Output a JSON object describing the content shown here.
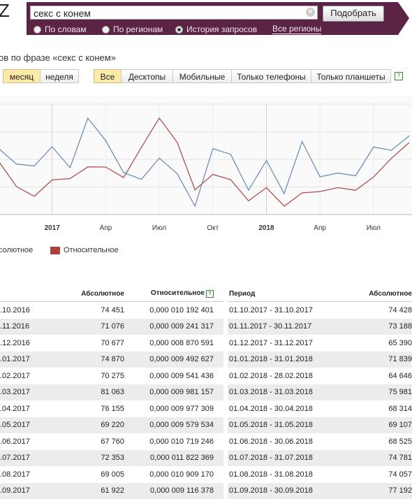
{
  "search": {
    "value": "секс с конем",
    "submit_label": "Подобрать",
    "modes": [
      "По словам",
      "По регионам",
      "История запросов"
    ],
    "selected_mode": "История запросов",
    "region_link": "Все регионы"
  },
  "corner_glyph": "Z",
  "subtitle": "ов по фразе «секс с конем»",
  "period_tabs": [
    "месяц",
    "неделя"
  ],
  "selected_period": "месяц",
  "device_tabs": [
    "Все",
    "Десктопы",
    "Мобильные",
    "Только телефоны",
    "Только планшеты"
  ],
  "selected_device": "Все",
  "legend": {
    "absolute": "солютное",
    "relative": "Относительное"
  },
  "colors": {
    "absolute": "#6f8fb8",
    "relative": "#b05050",
    "header": "#5b2446",
    "selected_tab": "#fde9a8"
  },
  "chart_data": {
    "type": "line",
    "x": [
      "2016-10",
      "2016-11",
      "2016-12",
      "2017-01",
      "2017-02",
      "2017-03",
      "2017-04",
      "2017-05",
      "2017-06",
      "2017-07",
      "2017-08",
      "2017-09",
      "2017-10",
      "2017-11",
      "2017-12",
      "2018-01",
      "2018-02",
      "2018-03",
      "2018-04",
      "2018-05",
      "2018-06",
      "2018-07",
      "2018-08",
      "2018-09"
    ],
    "x_tick_labels": [
      "2017",
      "Апр",
      "Июл",
      "Окт",
      "2018",
      "Апр",
      "Июл"
    ],
    "series": [
      {
        "name": "Абсолютное",
        "values": [
          74451,
          71076,
          70677,
          74870,
          70275,
          81063,
          76155,
          69220,
          67760,
          72353,
          69005,
          61922,
          74428,
          73188,
          65390,
          71839,
          64646,
          75981,
          68314,
          69107,
          68525,
          74781,
          74057,
          77192
        ]
      },
      {
        "name": "Относительное",
        "values": [
          1.0192401e-05,
          9.241317e-06,
          8.870591e-06,
          9.492627e-06,
          9.541436e-06,
          9.981157e-06,
          9.977309e-06,
          9.579534e-06,
          1.0719246e-05,
          1.1822369e-05,
          1.090917e-05,
          9.116378e-06,
          9.7e-06,
          9.5e-06,
          8.7e-06,
          9.2e-06,
          8.5e-06,
          9e-06,
          9.05e-06,
          9.2e-06,
          9.1e-06,
          9.6e-06,
          1.03e-05,
          1.09e-05
        ]
      }
    ],
    "grid": true
  },
  "table_left": {
    "headers": [
      "Абсолютное",
      "Относительное"
    ],
    "rows": [
      [
        ".10.2016",
        "74 451",
        "0,000 010 192 401"
      ],
      [
        ".11.2016",
        "71 076",
        "0,000 009 241 317"
      ],
      [
        ".12.2016",
        "70 677",
        "0,000 008 870 591"
      ],
      [
        ".01.2017",
        "74 870",
        "0,000 009 492 627"
      ],
      [
        ".02.2017",
        "70 275",
        "0,000 009 541 436"
      ],
      [
        ".03.2017",
        "81 063",
        "0,000 009 981 157"
      ],
      [
        ".04.2017",
        "76 155",
        "0,000 009 977 309"
      ],
      [
        ".05.2017",
        "69 220",
        "0,000 009 579 534"
      ],
      [
        ".06.2017",
        "67 760",
        "0,000 010 719 246"
      ],
      [
        ".07.2017",
        "72 353",
        "0,000 011 822 369"
      ],
      [
        ".08.2017",
        "69 005",
        "0,000 010 909 170"
      ],
      [
        ".09.2017",
        "61 922",
        "0,000 009 116 378"
      ]
    ]
  },
  "table_right": {
    "headers": [
      "Период",
      "Абсолютное"
    ],
    "rows": [
      [
        "01.10.2017 - 31.10.2017",
        "74 428"
      ],
      [
        "01.11.2017 - 30.11.2017",
        "73 188"
      ],
      [
        "01.12.2017 - 31.12.2017",
        "65 390"
      ],
      [
        "01.01.2018 - 31.01.2018",
        "71 839"
      ],
      [
        "01.02.2018 - 28.02.2018",
        "64 646"
      ],
      [
        "01.03.2018 - 31.03.2018",
        "75 981"
      ],
      [
        "01.04.2018 - 30.04.2018",
        "68 314"
      ],
      [
        "01.05.2018 - 31.05.2018",
        "69 107"
      ],
      [
        "01.06.2018 - 30.06.2018",
        "68 525"
      ],
      [
        "01.07.2018 - 31.07.2018",
        "74 781"
      ],
      [
        "01.08.2018 - 31.08.2018",
        "74 057"
      ],
      [
        "01.09.2018 - 30.09.2018",
        "77 192"
      ]
    ]
  }
}
